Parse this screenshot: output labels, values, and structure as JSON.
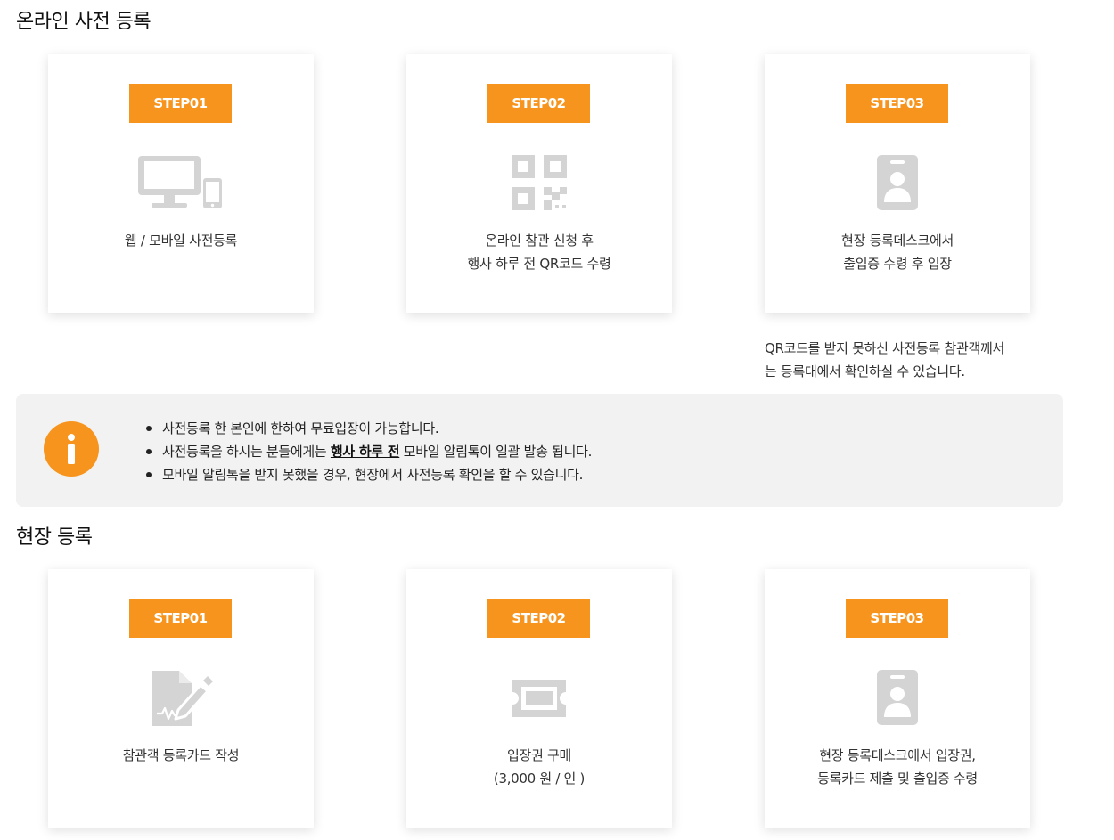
{
  "colors": {
    "accent": "#f7941d",
    "icon_gray": "#d4d4d4",
    "info_bg": "#f2f2f2"
  },
  "online": {
    "title": "온라인 사전 등록",
    "steps": [
      {
        "badge": "STEP01",
        "icon": "monitor-mobile-icon",
        "lines": [
          "웹 / 모바일 사전등록"
        ]
      },
      {
        "badge": "STEP02",
        "icon": "qr-code-icon",
        "lines": [
          "온라인 참관 신청 후",
          "행사 하루 전 QR코드 수령"
        ]
      },
      {
        "badge": "STEP03",
        "icon": "id-badge-icon",
        "lines": [
          "현장 등록데스크에서",
          "출입증 수령 후 입장"
        ]
      }
    ],
    "note": [
      "QR코드를 받지 못하신 사전등록 참관객께서",
      "는 등록대에서 확인하실 수 있습니다."
    ]
  },
  "info": {
    "icon": "info-icon",
    "items": [
      {
        "text": "사전등록 한 본인에 한하여 무료입장이 가능합니다."
      },
      {
        "before": "사전등록을 하시는 분들에게는 ",
        "bold": "행사 하루 전",
        "after": " 모바일 알림톡이 일괄 발송 됩니다."
      },
      {
        "text": "모바일 알림톡을 받지 못했을 경우, 현장에서 사전등록 확인을 할 수 있습니다."
      }
    ]
  },
  "onsite": {
    "title": "현장 등록",
    "steps": [
      {
        "badge": "STEP01",
        "icon": "registration-form-icon",
        "lines": [
          "참관객 등록카드 작성"
        ]
      },
      {
        "badge": "STEP02",
        "icon": "ticket-icon",
        "lines": [
          "입장권 구매",
          "(3,000 원 / 인 )"
        ]
      },
      {
        "badge": "STEP03",
        "icon": "id-badge-icon",
        "lines": [
          "현장 등록데스크에서 입장권,",
          "등록카드 제출 및 출입증 수령"
        ]
      }
    ]
  }
}
